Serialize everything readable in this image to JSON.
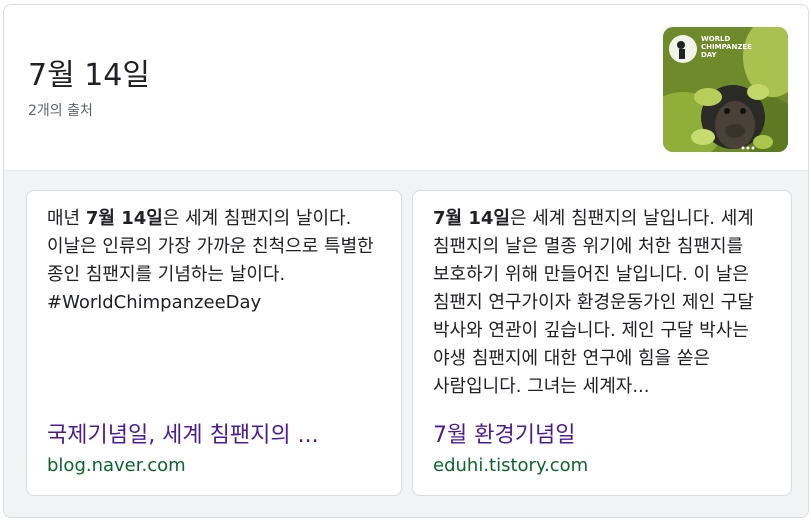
{
  "header": {
    "title": "7월 14일",
    "source_count": "2개의 출처",
    "thumbnail": {
      "logo_text": [
        "WORLD",
        "CHIMPANZEE",
        "DAY"
      ],
      "icon": "chimpanzee-photo"
    }
  },
  "sources": [
    {
      "snippet_bold": "7월 14일",
      "snippet_prefix": "매년 ",
      "snippet_rest": "은 세계 침팬지의 날이다. 이날은 인류의 가장 가까운 친척으로 특별한 종인 침팬지를 기념하는 날이다. #WorldChimpanzeeDay",
      "title": "국제기념일, 세계 침팬지의 ...",
      "url": "blog.naver.com"
    },
    {
      "snippet_bold": "7월 14일",
      "snippet_prefix": "",
      "snippet_rest": "은 세계 침팬지의 날입니다. 세계 침팬지의 날은 멸종 위기에 처한 침팬지를 보호하기 위해 만들어진 날입니다. 이 날은 침팬지 연구가이자 환경운동가인 제인 구달 박사와 연관이 깊습니다. 제인 구달 박사는 야생 침팬지에 대한 연구에 힘을 쏟은 사람입니다. 그녀는 세계자...",
      "title": "7월 환경기념일",
      "url": "eduhi.tistory.com"
    }
  ],
  "colors": {
    "link_title": "#4b1c9a",
    "url": "#0d652d",
    "body_bg": "#f1f3f4"
  }
}
